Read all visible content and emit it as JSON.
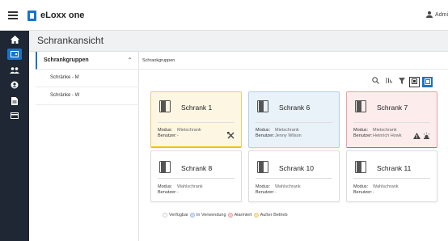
{
  "header": {
    "app_title": "eLoxx one",
    "user_label": "Admi"
  },
  "nav": {
    "items": [
      {
        "icon": "home-icon"
      },
      {
        "icon": "locker-icon",
        "active": true
      },
      {
        "icon": "users-icon"
      },
      {
        "icon": "user-badge-icon"
      },
      {
        "icon": "document-icon"
      },
      {
        "icon": "card-icon"
      }
    ]
  },
  "page": {
    "title": "Schrankansicht"
  },
  "groups": {
    "header": "Schrankgruppen",
    "items": [
      {
        "label": "Schränke - M"
      },
      {
        "label": "Schränke - W"
      }
    ]
  },
  "breadcrumb": "Schrankgruppen",
  "toolbar": {
    "icons": [
      "search-icon",
      "sort-icon",
      "filter-icon",
      "view-small-icon",
      "view-large-icon"
    ]
  },
  "lockers": [
    {
      "name": "Schrank 1",
      "modus_label": "Modus:",
      "modus": "Mietschrank",
      "benutzer_label": "Benutzer:",
      "benutzer": "-",
      "status": "in-use",
      "action": "tools-icon"
    },
    {
      "name": "Schrank 6",
      "modus_label": "Modus:",
      "modus": "Mietschrank",
      "benutzer_label": "Benutzer:",
      "benutzer": "Jenny Wilson",
      "status": "available"
    },
    {
      "name": "Schrank 7",
      "modus_label": "Modus:",
      "modus": "Mietschrank",
      "benutzer_label": "Benutzer:",
      "benutzer": "Heinrich Howk",
      "status": "alarm",
      "action": "warning-icon"
    },
    {
      "name": "Schrank 8",
      "modus_label": "Modus:",
      "modus": "Wahlschrank",
      "benutzer_label": "Benutzer:",
      "benutzer": "-",
      "status": "neutral"
    },
    {
      "name": "Schrank 10",
      "modus_label": "Modus:",
      "modus": "Wahlschrank",
      "benutzer_label": "Benutzer:",
      "benutzer": "-",
      "status": "neutral"
    },
    {
      "name": "Schrank 11",
      "modus_label": "Modus:",
      "modus": "Wahlschrank",
      "benutzer_label": "Benutzer:",
      "benutzer": "-",
      "status": "neutral"
    }
  ],
  "legend": [
    {
      "label": "Verfügbar",
      "color": "#ffffff"
    },
    {
      "label": "In Verwendung",
      "color": "#cfe0f5"
    },
    {
      "label": "Alarmiert",
      "color": "#f6d0d0"
    },
    {
      "label": "Außer Betrieb",
      "color": "#fbe7a8"
    }
  ],
  "colors": {
    "accent": "#1a73c8",
    "sidebar": "#1e2733",
    "in_use": "#f2c200",
    "alarm": "#e35555"
  }
}
